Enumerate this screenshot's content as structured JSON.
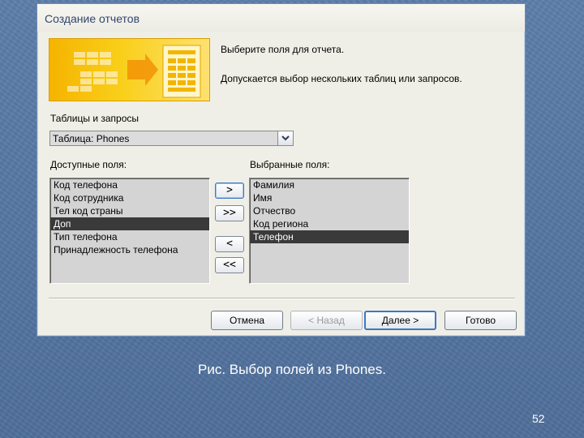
{
  "window": {
    "title": "Создание отчетов"
  },
  "intro": {
    "line1": "Выберите поля для отчета.",
    "line2": "Допускается выбор нескольких таблиц или запросов."
  },
  "source": {
    "label": "Таблицы и запросы",
    "selected": "Таблица: Phones"
  },
  "available": {
    "label": "Доступные поля:",
    "items": [
      "Код телефона",
      "Код сотрудника",
      "Тел код страны",
      "Доп",
      "Тип телефона",
      "Принадлежность телефона"
    ],
    "selected_index": 3
  },
  "chosen": {
    "label": "Выбранные поля:",
    "items": [
      "Фамилия",
      "Имя",
      "Отчество",
      "Код региона",
      "Телефон"
    ],
    "selected_index": 4
  },
  "move_buttons": {
    "add_one": ">",
    "add_all": ">>",
    "remove_one": "<",
    "remove_all": "<<"
  },
  "footer_buttons": {
    "cancel": "Отмена",
    "back": "< Назад",
    "next": "Далее >",
    "finish": "Готово"
  },
  "slide": {
    "caption": "Рис. Выбор полей из Phones.",
    "page_number": "52"
  },
  "colors": {
    "banner": "#f5b400",
    "selection": "#3a3a3a",
    "focus": "#3d78c2"
  }
}
